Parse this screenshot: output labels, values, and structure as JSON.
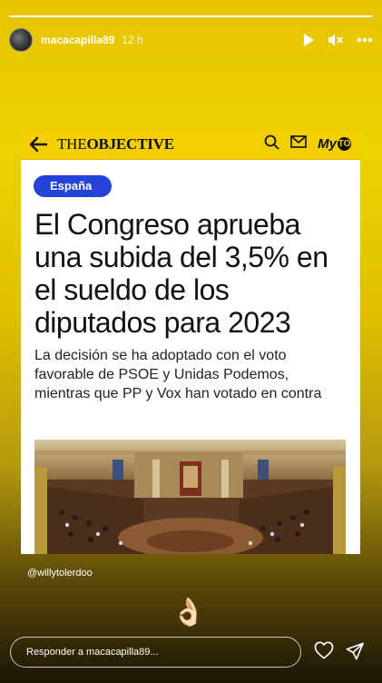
{
  "story": {
    "username": "macacapilla89",
    "time_ago": "12 h",
    "progress": 1.0
  },
  "icons": {
    "play": "play-icon",
    "mute": "mute-icon",
    "more": "more-icon",
    "back": "back-arrow-icon",
    "search": "search-icon",
    "mail": "mail-icon",
    "heart": "heart-icon",
    "send": "send-icon"
  },
  "article": {
    "site_logo_prefix": "THE",
    "site_logo_brand": "OBJECTIVE",
    "myto_label_prefix": "My",
    "myto_label_o": "TO",
    "category": "España",
    "headline": "El Congreso aprueba una subida del 3,5% en el sueldo de los diputados para 2023",
    "subtitle": "La decisión se ha adoptado con el voto favorable de PSOE y Unidas Podemos, mientras que PP y Vox han votado en contra"
  },
  "mention": "@willytolerdoo",
  "sticker_emoji": "👌🏻",
  "reply": {
    "placeholder": "Responder a macacapilla89..."
  },
  "colors": {
    "site_yellow": "#f3cf00",
    "badge_blue": "#2443d9",
    "story_bg_top": "#e6c400",
    "story_bg_bottom": "#1b1505"
  }
}
